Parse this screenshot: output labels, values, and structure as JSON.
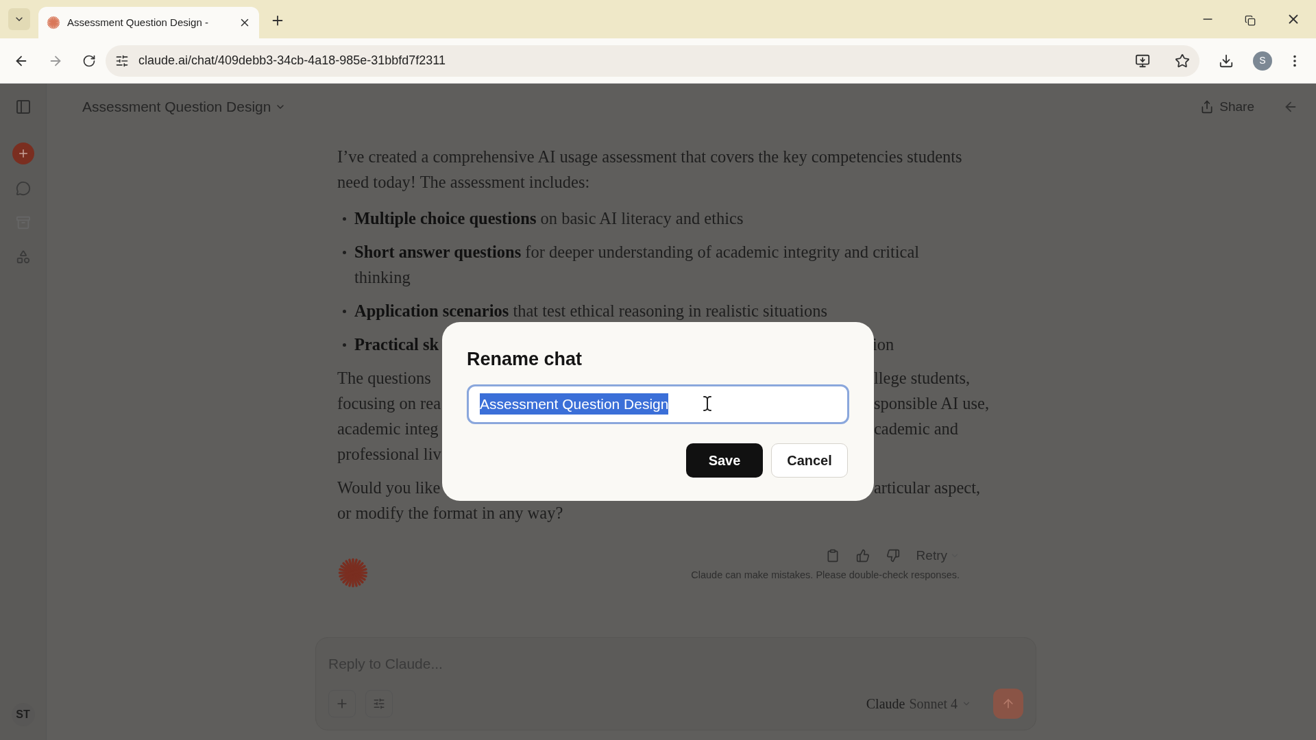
{
  "browser": {
    "tab_title": "Assessment Question Design -",
    "url": "claude.ai/chat/409debb3-34cb-4a18-985e-31bbfd7f2311",
    "profile_initial": "S"
  },
  "sidebar": {
    "user_initials": "ST"
  },
  "header": {
    "title": "Assessment Question Design",
    "share": "Share"
  },
  "message": {
    "intro": "I’ve created a comprehensive AI usage assessment that covers the key competencies students need today! The assessment includes:",
    "bullets": [
      "**Multiple choice questions** on basic AI literacy and ethics",
      "**Short answer questions** for deeper understanding of academic integrity and critical thinking",
      "**Application scenarios** that test ethical reasoning in realistic situations"
    ],
    "covered_bullet": {
      "left": "Practical sk",
      "right": "ion"
    },
    "covered_paragraphs": [
      [
        {
          "left": "The questions",
          "right": "llege students,"
        },
        {
          "left": "focusing on rea",
          "right": "sponsible AI use,"
        },
        {
          "left": "academic integ",
          "right": "cademic and"
        },
        {
          "left": "professional liv"
        }
      ],
      [
        {
          "left": "Would you like",
          "right": "articular aspect,"
        }
      ]
    ],
    "closing_line": "or modify the format in any way?",
    "retry": "Retry",
    "disclaimer": "Claude can make mistakes. Please double-check responses."
  },
  "composer": {
    "placeholder": "Reply to Claude...",
    "brand": "Claude",
    "model": "Sonnet 4"
  },
  "dialog": {
    "title": "Rename chat",
    "value": "Assessment Question Design",
    "text_selected": true,
    "buttons": [
      {
        "label": "Save",
        "kind": "primary"
      },
      {
        "label": "Cancel",
        "kind": "secondary"
      }
    ]
  }
}
